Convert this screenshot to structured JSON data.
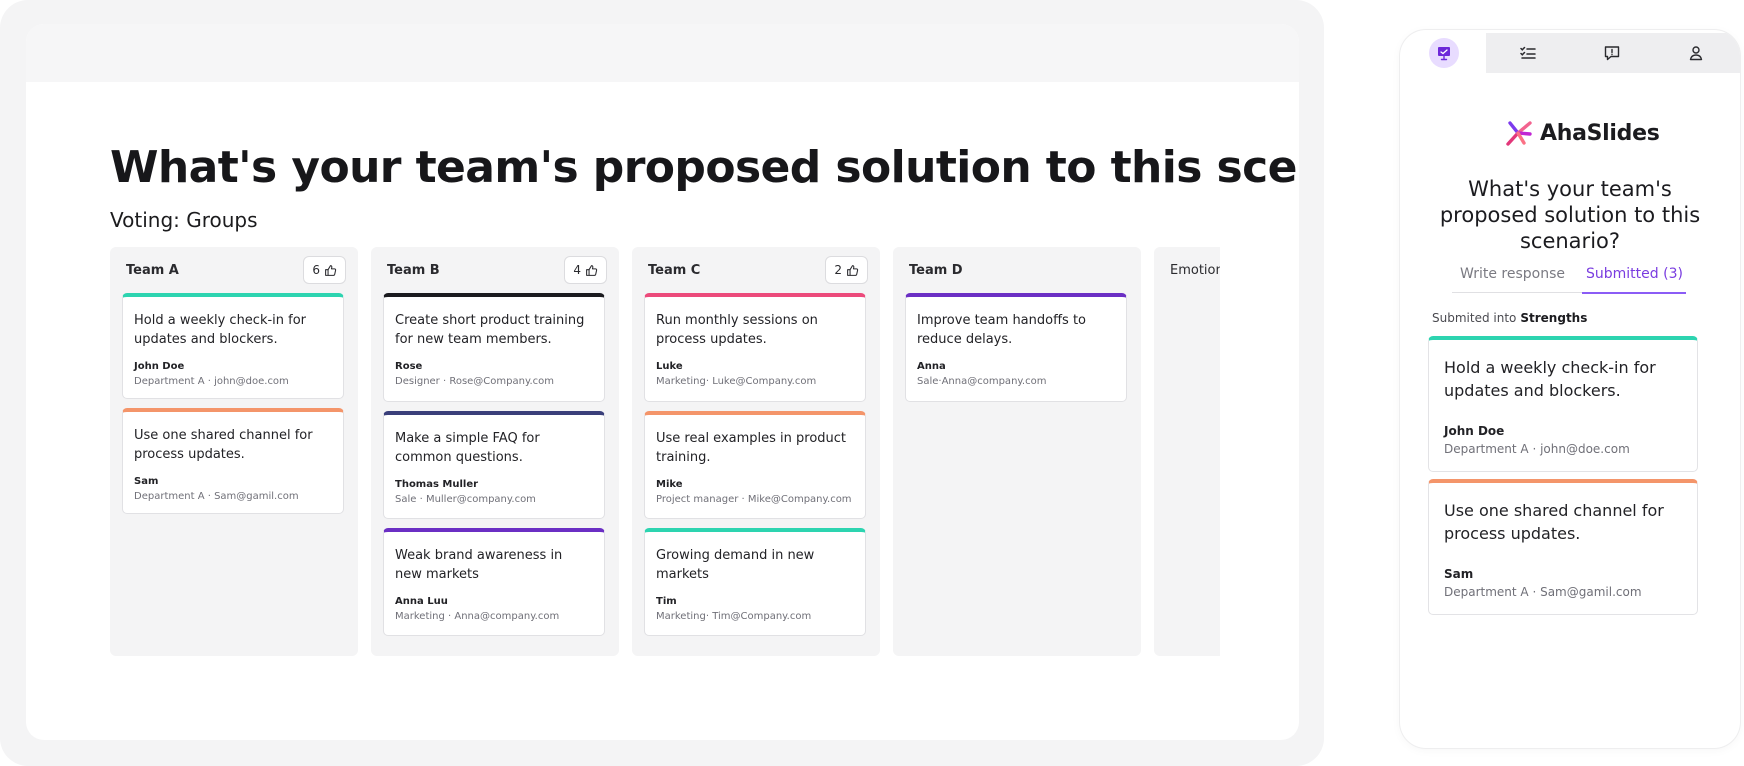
{
  "presenter": {
    "title": "What's your team's proposed solution to this scenario",
    "subtitle": "Voting: Groups",
    "columns": [
      {
        "name": "Team A",
        "votes": "6",
        "cards": [
          {
            "text": "Hold a weekly check-in for updates and blockers.",
            "author": "John Doe",
            "meta": "Department A · john@doe.com",
            "color": "#2dd4b0"
          },
          {
            "text": "Use one shared channel for process updates.",
            "author": "Sam",
            "meta": "Department A · Sam@gamil.com",
            "color": "#f4956a"
          }
        ]
      },
      {
        "name": "Team B",
        "votes": "4",
        "cards": [
          {
            "text": "Create short product training for new team members.",
            "author": "Rose",
            "meta": "Designer · Rose@Company.com",
            "color": "#1b1b1f"
          },
          {
            "text": "Make a simple FAQ for common questions.",
            "author": "Thomas Muller",
            "meta": "Sale · Muller@company.com",
            "color": "#3a3f7a"
          },
          {
            "text": "Weak brand awareness in new markets",
            "author": "Anna Luu",
            "meta": "Marketing · Anna@company.com",
            "color": "#6b2fc4"
          }
        ]
      },
      {
        "name": "Team C",
        "votes": "2",
        "cards": [
          {
            "text": "Run monthly sessions on process updates.",
            "author": "Luke",
            "meta": "Marketing· Luke@Company.com",
            "color": "#ec4a7b"
          },
          {
            "text": " Use real examples in product training.",
            "author": "Mike",
            "meta": "Project manager · Mike@Company.com",
            "color": "#f4956a"
          },
          {
            "text": "Growing demand in new markets",
            "author": "Tim",
            "meta": "Marketing· Tim@Company.com",
            "color": "#2dd4b0"
          }
        ]
      },
      {
        "name": "Team D",
        "votes": "",
        "cards": [
          {
            "text": "Improve team handoffs to reduce delays.",
            "author": "Anna",
            "meta": "Sale·Anna@company.com",
            "color": "#6b2fc4"
          }
        ]
      },
      {
        "name": "Emotion",
        "votes": "",
        "cards": []
      }
    ]
  },
  "participant": {
    "nav_icons": [
      "presentation-icon",
      "checklist-icon",
      "chat-icon",
      "user-icon"
    ],
    "brand": "AhaSlides",
    "question": "What's your team's proposed solution to this scenario?",
    "tabs": {
      "write": "Write response",
      "submitted": "Submitted (3)"
    },
    "submitted_into_label": "Submited into",
    "submitted_into_value": "Strengths",
    "cards": [
      {
        "text": "Hold a weekly check-in for updates and blockers.",
        "author": "John Doe",
        "meta": "Department A · john@doe.com",
        "color": "#2dd4b0"
      },
      {
        "text": "Use one shared channel for process updates.",
        "author": "Sam",
        "meta": "Department A · Sam@gamil.com",
        "color": "#f4956a"
      }
    ]
  }
}
